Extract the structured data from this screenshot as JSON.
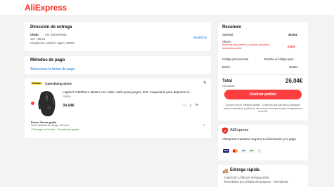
{
  "app": {
    "logo": "AliExpress"
  },
  "address": {
    "title": "Dirección de entrega",
    "name": "Cholo",
    "phone": "+34 3023879845",
    "line1": "137 / 58 23",
    "line2": "Chapinería, Madrid, Spain, 28001",
    "edit": "Modificar"
  },
  "payment": {
    "title": "Métodos de pago",
    "select": "Selecciona la forma de pago"
  },
  "store": {
    "badge": "Choice",
    "name": "Cutesliving Store",
    "product_title": "Logitech G502hero Master con cable, ratón para juegos, 502, maquinaria para deportes el...",
    "variant": "G502A",
    "price": "30,04€",
    "qty": "1",
    "shipping_title": "Envío: Envío gratis",
    "shipping_sub": "Fecha estimada de entrega: 19-21 jun.",
    "delivery_note": "Entrega en 5 días · Devolución gratis"
  },
  "summary": {
    "title": "Resumen",
    "subtotal_label": "Subtotal",
    "subtotal_value": "30,04€",
    "saving_label": "Ahorro",
    "saving_note": "Máximos descuentos y cupones aplicados automáticamente",
    "saving_value": "-4,00€",
    "promo_label": "Código promocional",
    "promo_value": "Escribe el código aquí",
    "shipping_label": "Envío",
    "shipping_value": "Gratis",
    "total_label": "Total",
    "total_value": "26,04€",
    "vat_note": "IVA incluido",
    "button": "Realizar pedido",
    "legal": "Al hacer clic en \"Realizar pedido\", confirmas que has leído y aceptado todos los términos y políticas, así como la información para consumidores en la UE."
  },
  "trust": {
    "logo": "AliExpress",
    "text": "AliExpress mantiene seguros tu información y tu pago",
    "badges": [
      "VISA",
      "MC",
      "PP",
      "SSL",
      "✓"
    ]
  },
  "fast": {
    "title": "Entrega rápida",
    "line1": "Cupón de 1,00€ por entrega tardía",
    "line2": "Reembolso por pérdida del paquete · Reembolso"
  }
}
